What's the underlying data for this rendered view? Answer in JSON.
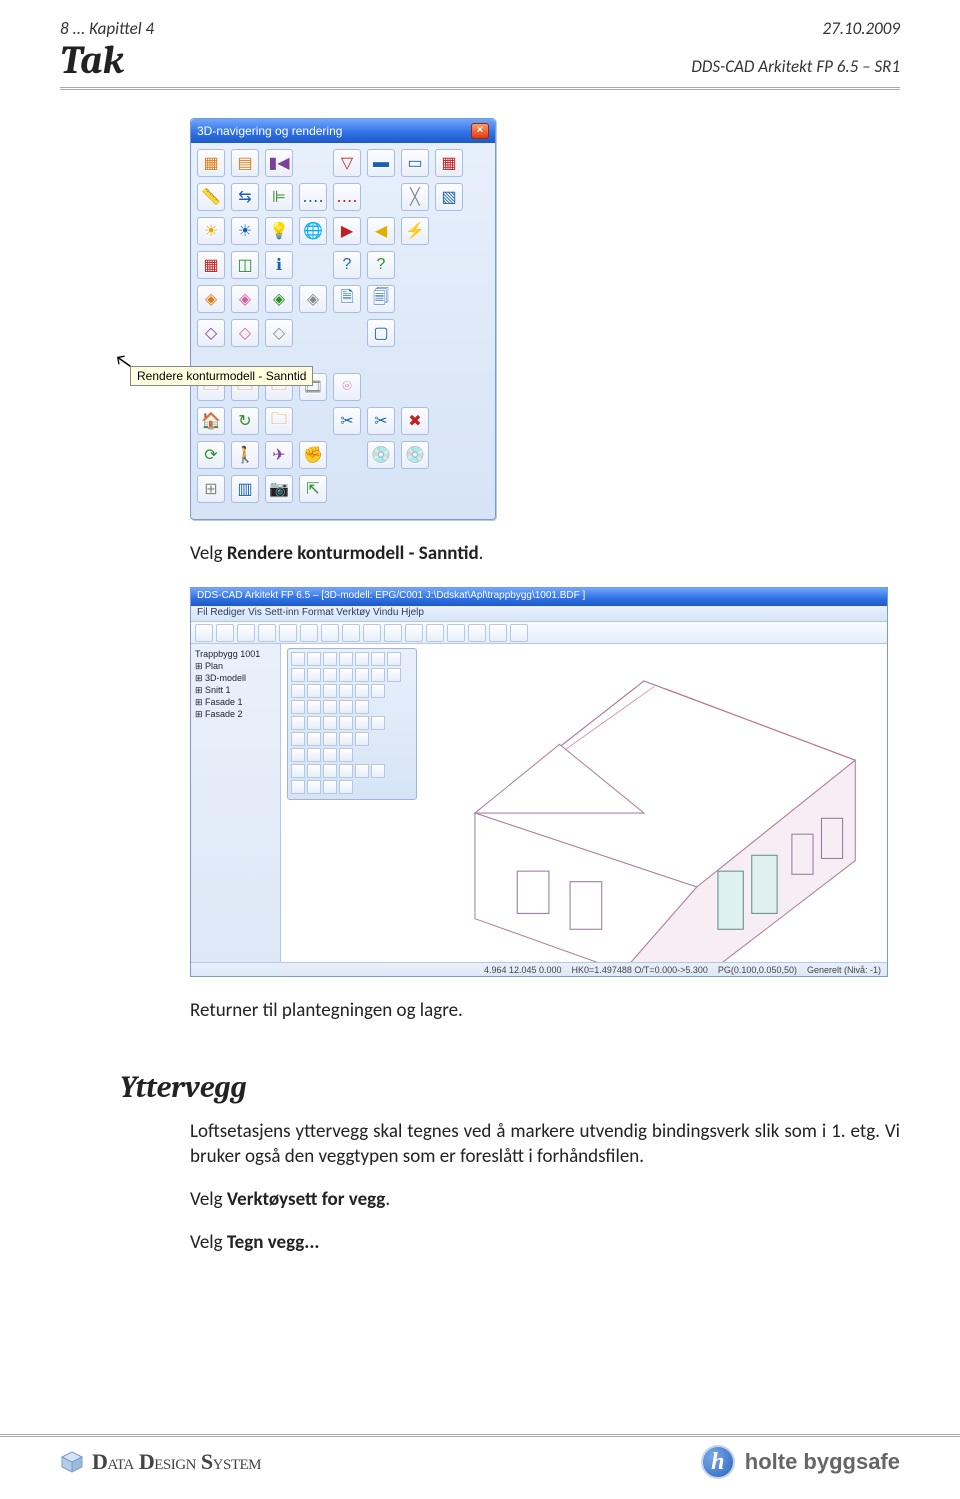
{
  "header": {
    "left": "8 ... Kapittel 4",
    "right": "27.10.2009",
    "title_left": "Tak",
    "title_right": "DDS-CAD Arkitekt  FP  6.5 – SR1"
  },
  "toolbox": {
    "title": "3D-navigering og rendering",
    "tooltip": "Rendere konturmodell - Sanntid"
  },
  "app": {
    "title": "DDS-CAD Arkitekt FP 6.5 – [3D-modell: EPG/C001 J:\\Ddskat\\Apl\\trappbygg\\1001.BDF ]",
    "menubar": "Fil  Rediger  Vis  Sett-inn  Format  Verktøy  Vindu  Hjelp",
    "tree": [
      "Trappbygg 1001",
      "⊞ Plan",
      "⊞ 3D-modell",
      "  ⊞ Snitt 1",
      "  ⊞ Fasade 1",
      "  ⊞ Fasade 2"
    ],
    "status": [
      "4.964   12.045    0.000",
      "HK0=1.497488   O/T=0.000->5.300",
      "PG(0.100,0.050,50)",
      "Generelt (Nivå: -1)"
    ]
  },
  "body": {
    "p1_pre": "Velg ",
    "p1_bold": "Rendere konturmodell - Sanntid",
    "p1_post": ".",
    "p2": "Returner til plantegningen og lagre."
  },
  "section": {
    "title": "Yttervegg",
    "p1": "Loftsetasjens yttervegg skal tegnes ved å markere utvendig bindingsverk slik som i 1. etg. Vi bruker også den veggtypen som er foreslått i forhåndsfilen.",
    "p2_pre": "Velg ",
    "p2_bold": "Verktøysett for vegg",
    "p2_post": ".",
    "p3_pre": "Velg ",
    "p3_bold": "Tegn vegg...",
    "p3_post": ""
  },
  "footer": {
    "dds": "DATA DESIGN SYSTEM",
    "holte": "holte byggsafe"
  }
}
